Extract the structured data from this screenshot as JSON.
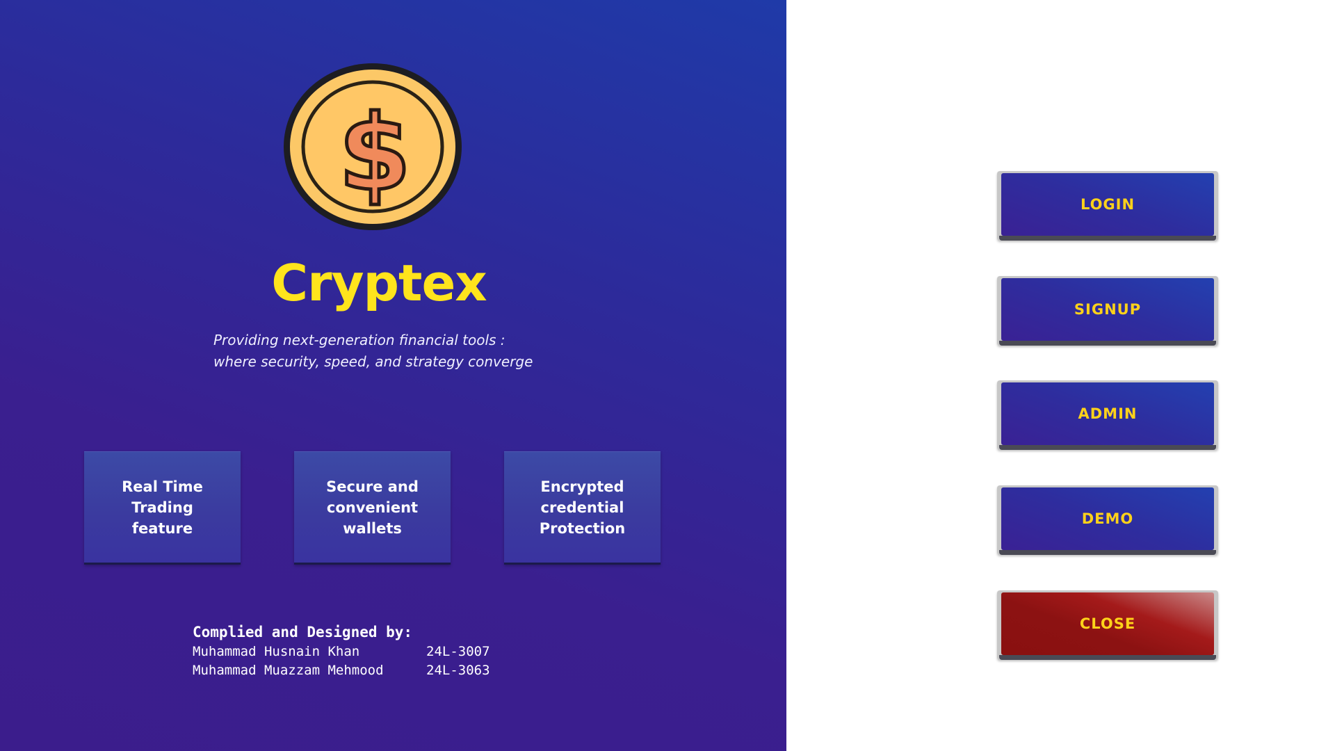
{
  "app": {
    "title": "Cryptex",
    "tagline_line1": "Providing next-generation financial tools :",
    "tagline_line2": "where security, speed, and strategy converge",
    "logo_icon": "dollar-coin-icon"
  },
  "features": [
    {
      "label": "Real Time Trading\nfeature"
    },
    {
      "label": "Secure and\nconvenient wallets"
    },
    {
      "label": "Encrypted\ncredential\nProtection"
    }
  ],
  "credits": {
    "heading": "Complied and Designed by:",
    "authors": [
      {
        "name": "Muhammad Husnain Khan",
        "id": "24L-3007"
      },
      {
        "name": "Muhammad Muazzam Mehmood",
        "id": "24L-3063"
      }
    ]
  },
  "menu": {
    "login": "LOGIN",
    "signup": "SIGNUP",
    "admin": "ADMIN",
    "demo": "DEMO",
    "close": "CLOSE"
  },
  "colors": {
    "accent_yellow": "#ffe41c",
    "button_text": "#ffd21a",
    "panel_blue": "#2d2a9a",
    "close_red": "#8c1212"
  }
}
